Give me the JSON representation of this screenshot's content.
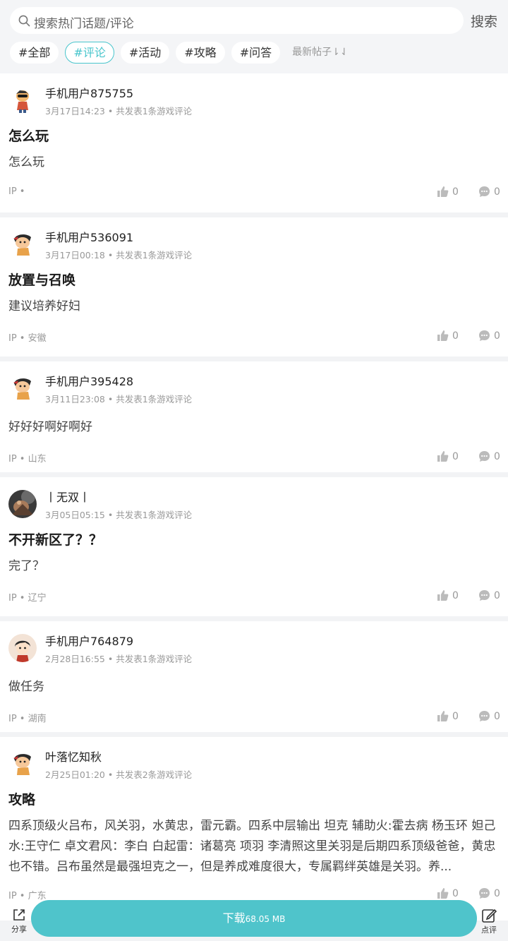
{
  "search": {
    "placeholder": "搜索热门话题/评论",
    "button_label": "搜索"
  },
  "tags": [
    {
      "label": "#全部"
    },
    {
      "label": "#评论",
      "active": true
    },
    {
      "label": "#活动"
    },
    {
      "label": "#攻略"
    },
    {
      "label": "#问答"
    }
  ],
  "sort_label": "最新帖子⇂⇃",
  "posts": [
    {
      "username": "手机用户875755",
      "meta": "3月17日14:23 • 共发表1条游戏评论",
      "title": "怎么玩",
      "body": "怎么玩",
      "ip": "IP •",
      "likes": "0",
      "comments": "0"
    },
    {
      "username": "手机用户536091",
      "meta": "3月17日00:18 • 共发表1条游戏评论",
      "title": "放置与召唤",
      "body": "建议培养好妇",
      "ip": "IP • 安徽",
      "likes": "0",
      "comments": "0"
    },
    {
      "username": "手机用户395428",
      "meta": "3月11日23:08 • 共发表1条游戏评论",
      "title": "",
      "body": "好好好啊好啊好",
      "ip": "IP • 山东",
      "likes": "0",
      "comments": "0"
    },
    {
      "username": "丨无双丨",
      "meta": "3月05日05:15 • 共发表1条游戏评论",
      "title": "不开新区了？？",
      "body": "完了？",
      "ip": "IP • 辽宁",
      "likes": "0",
      "comments": "0"
    },
    {
      "username": "手机用户764879",
      "meta": "2月28日16:55 • 共发表1条游戏评论",
      "title": "",
      "body": "做任务",
      "ip": "IP • 湖南",
      "likes": "0",
      "comments": "0"
    },
    {
      "username": "叶落忆知秋",
      "meta": "2月25日01:20 • 共发表2条游戏评论",
      "title": "攻略",
      "body": "四系顶级火吕布，风关羽，水黄忠，雷元霸。四系中层输出 坦克 辅助火:霍去病 杨玉环 妲己水:王守仁 卓文君风：李白 白起雷：诸葛亮 项羽 李清照这里关羽是后期四系顶级爸爸，黄忠也不错。吕布虽然是最强坦克之一，但是养成难度很大，专属羁绊英雄是关羽。养...",
      "ip": "IP • 广东",
      "likes": "0",
      "comments": "0"
    }
  ],
  "bottom_bar": {
    "share_label": "分享",
    "download_label": "下载",
    "download_size": "68.05 MB",
    "review_label": "点评"
  }
}
